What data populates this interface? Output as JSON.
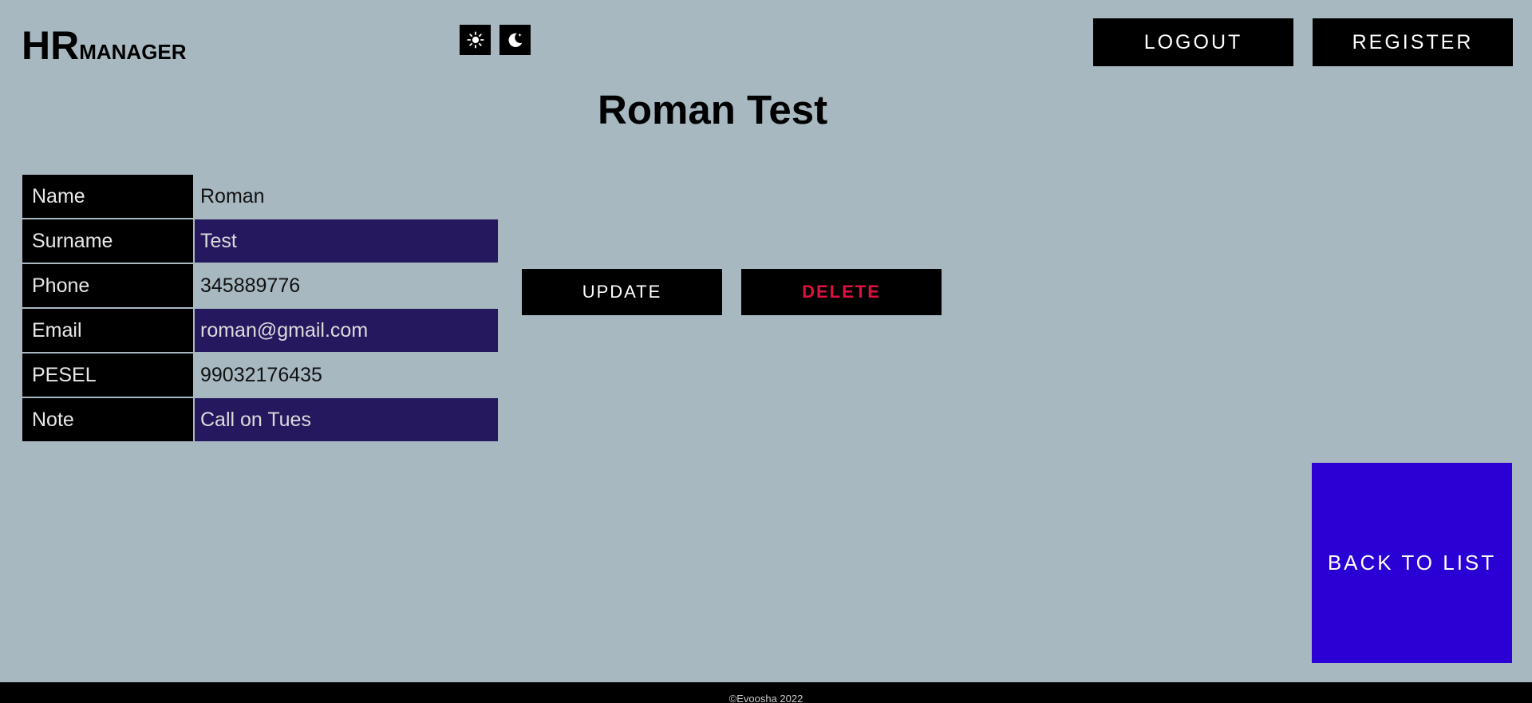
{
  "logo": {
    "big": "HR",
    "small": "MANAGER"
  },
  "theme": {
    "light_icon": "sun-icon",
    "dark_icon": "moon-icon"
  },
  "header": {
    "logout_label": "LOGOUT",
    "register_label": "REGISTER"
  },
  "title": "Roman Test",
  "details": [
    {
      "key": "Name",
      "value": "Roman"
    },
    {
      "key": "Surname",
      "value": "Test"
    },
    {
      "key": "Phone",
      "value": "345889776"
    },
    {
      "key": "Email",
      "value": "roman@gmail.com"
    },
    {
      "key": "PESEL",
      "value": "99032176435"
    },
    {
      "key": "Note",
      "value": "Call on Tues"
    }
  ],
  "actions": {
    "update_label": "UPDATE",
    "delete_label": "DELETE",
    "back_label": "BACK TO LIST"
  },
  "footer": {
    "text": "©Evoosha 2022"
  },
  "colors": {
    "background": "#a7b8c1",
    "cell_dark": "#000000",
    "cell_purple": "#26185e",
    "delete_red": "#e0103f",
    "back_blue": "#2a00d4"
  }
}
